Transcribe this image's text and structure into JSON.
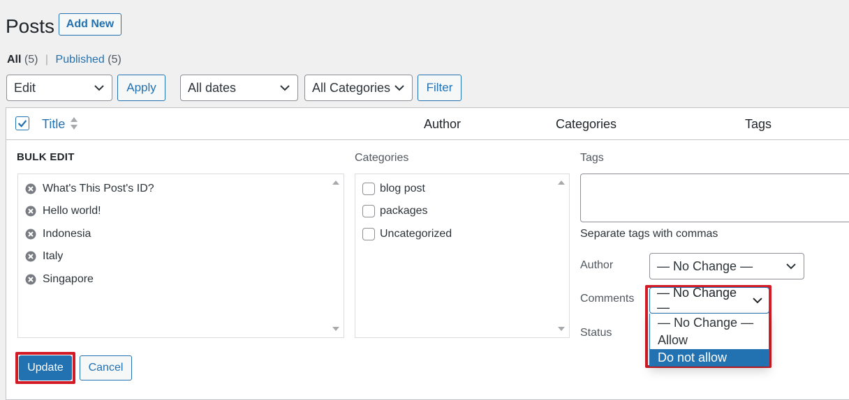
{
  "header": {
    "title": "Posts",
    "add_new": "Add New"
  },
  "filters": {
    "all_label": "All",
    "all_count": "(5)",
    "separator": "|",
    "published_label": "Published",
    "published_count": "(5)"
  },
  "toolbar": {
    "bulk_action": "Edit",
    "apply": "Apply",
    "dates": "All dates",
    "categories": "All Categories",
    "filter": "Filter"
  },
  "table": {
    "columns": {
      "title": "Title",
      "author": "Author",
      "categories": "Categories",
      "tags": "Tags"
    }
  },
  "bulk_edit": {
    "heading": "BULK EDIT",
    "posts": [
      "What's This Post's ID?",
      "Hello world!",
      "Indonesia",
      "Italy",
      "Singapore"
    ],
    "categories_label": "Categories",
    "categories": [
      "blog post",
      "packages",
      "Uncategorized"
    ],
    "tags_label": "Tags",
    "tags_hint": "Separate tags with commas",
    "author_label": "Author",
    "author_value": "— No Change —",
    "comments_label": "Comments",
    "comments_value": "— No Change —",
    "comments_options": [
      "— No Change —",
      "Allow",
      "Do not allow"
    ],
    "comments_selected_index": 2,
    "status_label": "Status",
    "update": "Update",
    "cancel": "Cancel"
  },
  "colors": {
    "accent": "#2271b1",
    "highlight": "#d21b24"
  }
}
